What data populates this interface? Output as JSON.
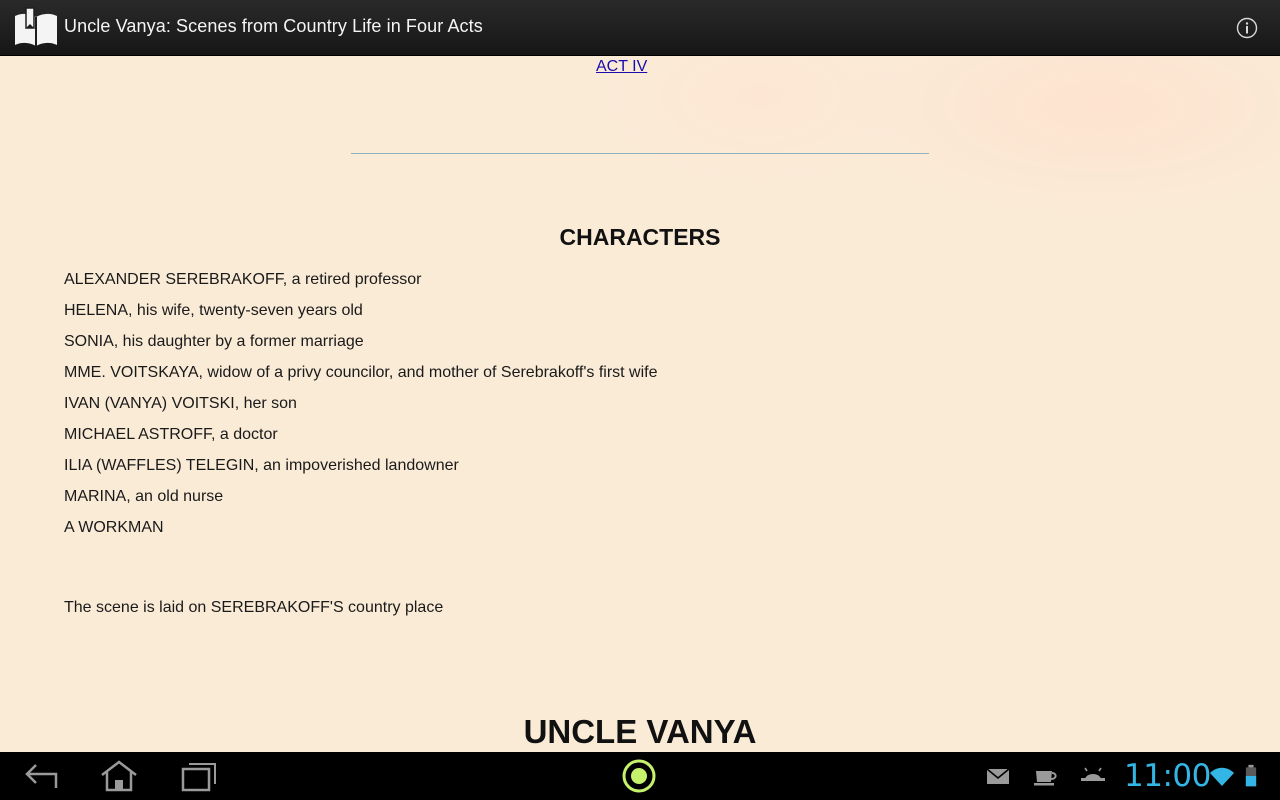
{
  "header": {
    "title": "Uncle Vanya: Scenes from Country Life in Four Acts"
  },
  "content": {
    "act_link": "ACT IV",
    "characters_heading": "CHARACTERS",
    "characters": [
      "ALEXANDER SEREBRAKOFF, a retired professor",
      "HELENA, his wife, twenty-seven years old",
      "SONIA, his daughter by a former marriage",
      "MME. VOITSKAYA, widow of a privy councilor, and mother of Serebrakoff's first wife",
      "IVAN (VANYA) VOITSKI, her son",
      "MICHAEL ASTROFF, a doctor",
      "ILIA (WAFFLES) TELEGIN, an impoverished landowner",
      "MARINA, an old nurse",
      "A WORKMAN"
    ],
    "scene_note": "The scene is laid on SEREBRAKOFF'S country place",
    "play_title": "UNCLE VANYA"
  },
  "status_bar": {
    "time": "11:00"
  },
  "icons": {
    "app": "book-icon",
    "info": "info-icon",
    "back": "back-icon",
    "home": "home-icon",
    "recents": "recent-apps-icon",
    "center": "launcher-dot-icon",
    "mail": "mail-icon",
    "coffee": "coffee-cup-icon",
    "android": "android-debug-icon",
    "wifi": "wifi-icon",
    "battery": "battery-icon"
  },
  "colors": {
    "page_background": "#faebd7",
    "link": "#1a0dab",
    "clock": "#33b5e5",
    "launcher_ring": "#c6f26b"
  }
}
